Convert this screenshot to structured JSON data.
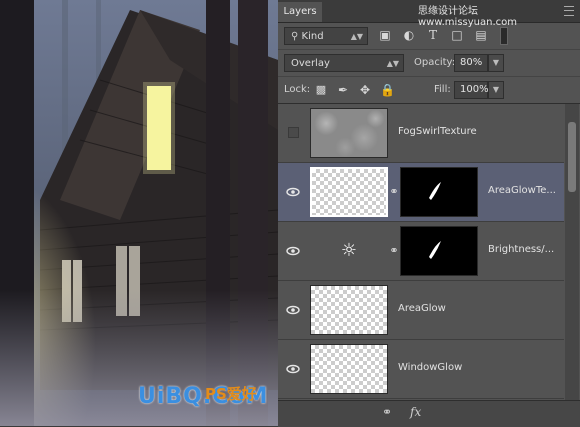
{
  "panel": {
    "tab_label": "Layers",
    "site_mark": "思缘设计论坛 www.missyuan.com",
    "filter": {
      "label": "Kind",
      "icon": "search-icon"
    },
    "filter_icons": [
      "image-filter-icon",
      "adjustment-filter-icon",
      "type-filter-icon",
      "shape-filter-icon",
      "smart-object-filter-icon",
      "filter-toggle-icon"
    ],
    "blend_mode": "Overlay",
    "opacity_label": "Opacity:",
    "opacity_value": "80%",
    "lock_label": "Lock:",
    "lock_icons": [
      "lock-transparent-icon",
      "lock-image-icon",
      "lock-position-icon",
      "lock-all-icon"
    ],
    "fill_label": "Fill:",
    "fill_value": "100%"
  },
  "layers": [
    {
      "name": "FogSwirlTexture",
      "visible": false,
      "selected": false,
      "type": "texture"
    },
    {
      "name": "AreaGlowTe...",
      "visible": true,
      "selected": true,
      "type": "masked"
    },
    {
      "name": "Brightness/...",
      "visible": true,
      "selected": false,
      "type": "adjustment"
    },
    {
      "name": "AreaGlow",
      "visible": true,
      "selected": false,
      "type": "pixel"
    },
    {
      "name": "WindowGlow",
      "visible": true,
      "selected": false,
      "type": "pixel"
    }
  ],
  "bottom_icons": [
    "link-layers-icon",
    "fx-icon"
  ],
  "watermark": {
    "text": "UiBQ.CoM",
    "text2": "PS爱好"
  }
}
